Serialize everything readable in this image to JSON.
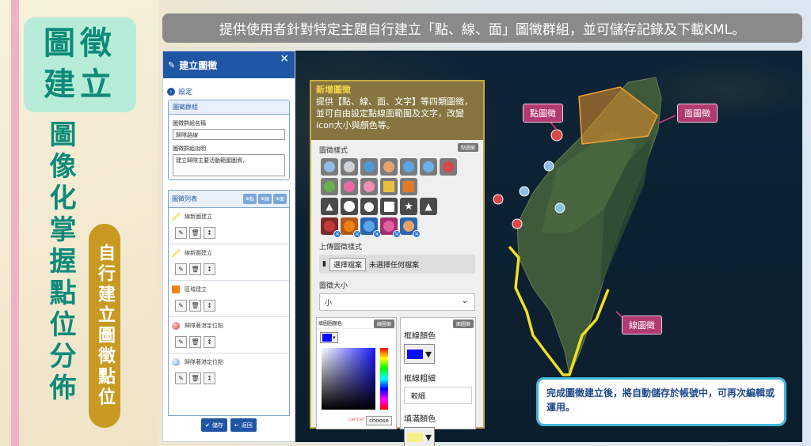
{
  "brand": {
    "logo_line1": "圖徵",
    "logo_line2": "建立",
    "vertical_title": "圖像化掌握點位分佈",
    "pill_text": "自行建立圖徵點位"
  },
  "banner": {
    "text": "提供使用者針對特定主題自行建立「點、線、面」圖徵群組，並可儲存記錄及下載KML。"
  },
  "dialog": {
    "title": "建立圖徵",
    "close": "×",
    "settings_label": "設定",
    "group_title": "圖徵群組",
    "name_label": "圖徵群組名稱",
    "name_value": "歸隊路線",
    "desc_label": "圖徵群組說明",
    "desc_value": "建立歸隊主要活動範圍圖資，",
    "list_title": "圖徵列表",
    "list_buttons": [
      "點",
      "線",
      "面"
    ],
    "items": [
      {
        "label": "線新圖建立",
        "marker": "line"
      },
      {
        "label": "線新圖建立",
        "marker": "line"
      },
      {
        "label": "區域建立",
        "marker": "square"
      },
      {
        "label": "歸隊著港定位點",
        "marker": "red"
      },
      {
        "label": "歸隊著港定位點",
        "marker": "blue"
      }
    ],
    "save_label": "儲存",
    "back_label": "返回"
  },
  "map": {
    "tags": {
      "point": "點圖徵",
      "polygon": "面圖徵",
      "line": "線圖徵"
    },
    "note": "完成圖徵建立後，將自動儲存於帳號中，可再次編輯或運用。",
    "colors": {
      "polygon_fill": "#e8922a",
      "line": "#f2e01e",
      "tag": "#b13a70",
      "note_border": "#3fb6d8"
    }
  },
  "popup": {
    "title": "新增圖徵",
    "desc": "提供【點、線、面、文字】等四類圖徵，並可自由設定點線面範圍及文字，改變icon大小與顏色等。",
    "style_label": "圖徵樣式",
    "style_tag": "點圖徵",
    "upload_label": "上傳圖徵樣式",
    "upload_button": "選擇檔案",
    "upload_status": "未選擇任何檔案",
    "size_label": "圖徵大小",
    "size_value": "小",
    "fill_label": "填圖圖顏色",
    "fill_tag": "線圖徵",
    "face_tag": "面圖徵",
    "border_color_label": "框線顏色",
    "border_width_label": "框線粗細",
    "border_width_value": "較細",
    "fill_color_label": "填滿顏色",
    "cancel": "cancel",
    "choose": "choose"
  }
}
